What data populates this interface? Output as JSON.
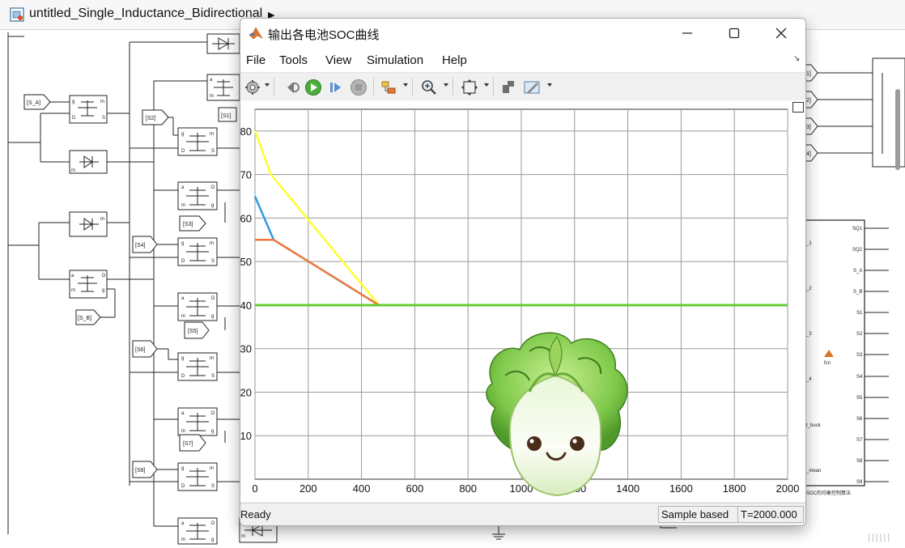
{
  "simulink": {
    "title": "untitled_Single_Inductance_Bidirectional",
    "left_tags": [
      "[S_A]",
      "[S2]",
      "[S1]",
      "[S3]",
      "[S4]",
      "[S_B]",
      "[S5]",
      "[S6]",
      "[S7]",
      "[S8]"
    ],
    "right_out_tags": [
      "1]",
      "2]",
      "3]",
      "4]"
    ],
    "fcn_block": {
      "ports_right": [
        "SQ1",
        "SQ2",
        "S_A",
        "S_B",
        "S1",
        "S2",
        "S3",
        "S4",
        "S5",
        "S6",
        "S7",
        "S8",
        "S9"
      ],
      "ports_left": [
        "_1",
        "_2",
        "_3",
        "_4",
        "t_buck",
        "_mean"
      ],
      "fcn_label": "fcn",
      "caption": "SOC的均衡控制算法"
    },
    "corner_mark": "||||||"
  },
  "scope": {
    "window_title": "输出各电池SOC曲线",
    "menu": [
      "File",
      "Tools",
      "View",
      "Simulation",
      "Help"
    ],
    "toolbar_icons": [
      "settings-gear-icon",
      "step-back-icon",
      "run-icon",
      "step-forward-icon",
      "stop-icon",
      "highlight-blocks-icon",
      "zoom-in-icon",
      "fit-to-view-icon",
      "cursor-measure-icon",
      "style-edit-icon"
    ],
    "status_left": "Ready",
    "status_mode": "Sample based",
    "status_time": "T=2000.000"
  },
  "chart_data": {
    "type": "line",
    "title": "",
    "xlabel": "",
    "ylabel": "",
    "xlim": [
      0,
      2000
    ],
    "ylim": [
      0,
      85
    ],
    "xticks": [
      0,
      200,
      400,
      600,
      800,
      1000,
      1200,
      1400,
      1600,
      1800,
      2000
    ],
    "yticks": [
      10,
      20,
      30,
      40,
      50,
      60,
      70,
      80
    ],
    "grid": true,
    "series": [
      {
        "color": "#ffff33",
        "x": [
          0,
          60,
          465,
          2000
        ],
        "y": [
          80,
          70,
          40,
          40
        ]
      },
      {
        "color": "#2f9be0",
        "x": [
          0,
          70,
          465,
          2000
        ],
        "y": [
          65,
          55,
          40,
          40
        ]
      },
      {
        "color": "#ef7a3c",
        "x": [
          0,
          70,
          465,
          2000
        ],
        "y": [
          55,
          55,
          40,
          40
        ]
      },
      {
        "color": "#66cc33",
        "x": [
          0,
          2000
        ],
        "y": [
          40,
          40
        ]
      }
    ]
  }
}
